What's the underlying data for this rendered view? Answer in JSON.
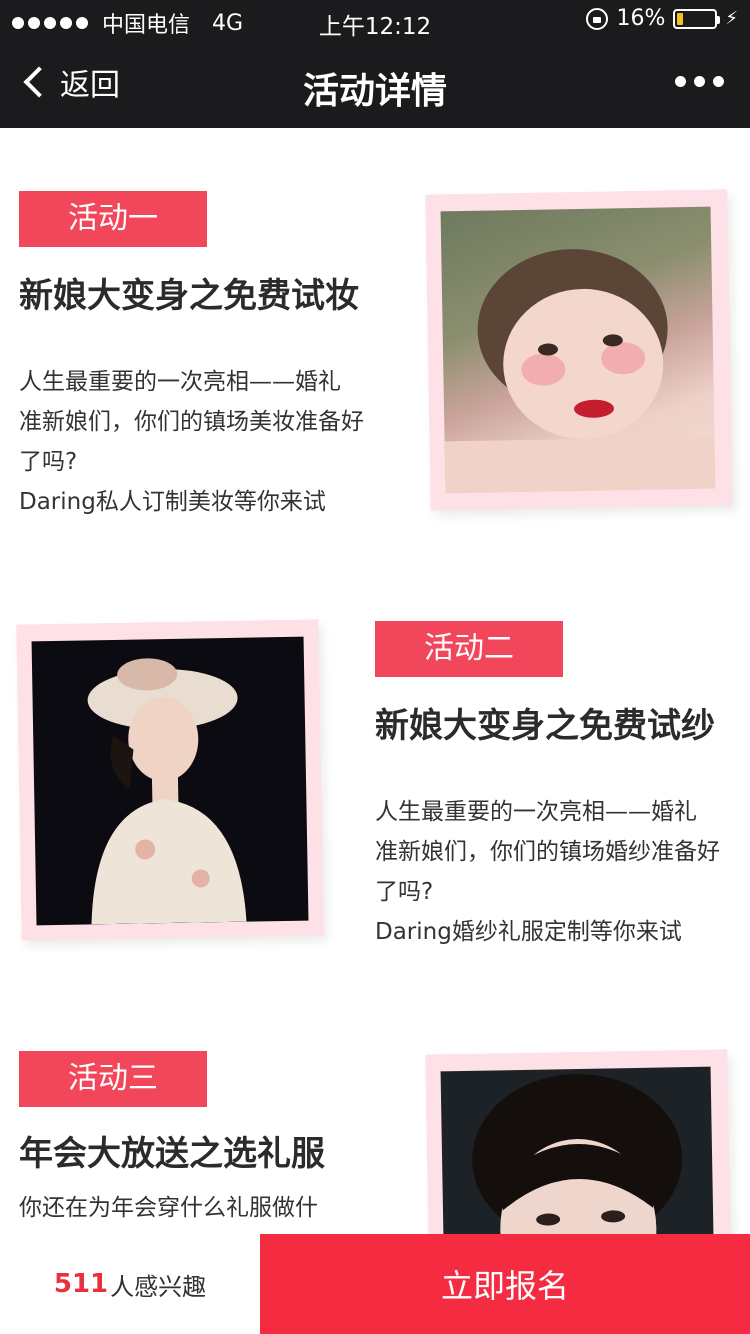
{
  "status_bar": {
    "carrier": "中国电信",
    "network": "4G",
    "time": "上午12:12",
    "battery": "16%",
    "battery_level": 0.16
  },
  "nav": {
    "back_label": "返回",
    "title": "活动详情"
  },
  "activities": [
    {
      "tag": "活动一",
      "title": "新娘大变身之免费试妆",
      "desc": [
        "人生最重要的一次亮相——婚礼",
        "准新娘们，你们的镇场美妆准备好了吗?",
        "Daring私人订制美妆等你来试"
      ]
    },
    {
      "tag": "活动二",
      "title": "新娘大变身之免费试纱",
      "desc": [
        "人生最重要的一次亮相——婚礼",
        "准新娘们，你们的镇场婚纱准备好了吗?",
        "Daring婚纱礼服定制等你来试"
      ]
    },
    {
      "tag": "活动三",
      "title": "年会大放送之选礼服",
      "desc": [
        "你还在为年会穿什么礼服做什"
      ]
    }
  ],
  "bottom": {
    "interest_count": "511",
    "interest_label": "人感兴趣",
    "signup_label": "立即报名"
  },
  "colors": {
    "accent": "#f2475b",
    "signup": "#f52c41",
    "frame": "#fde1e6",
    "bar": "#1b1b1d"
  }
}
